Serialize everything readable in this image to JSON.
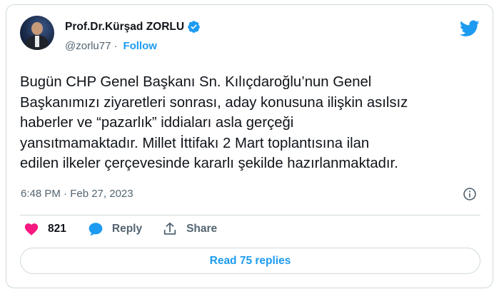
{
  "author": {
    "display_name": "Prof.Dr.Kürşad ZORLU",
    "handle": "@zorlu77",
    "separator": "·",
    "follow_label": "Follow"
  },
  "tweet": {
    "text": "Bugün CHP Genel Başkanı Sn. Kılıçdaroğlu’nun Genel\nBaşkanımızı ziyaretleri sonrası, aday konusuna ilişkin asılsız\nhaberler ve “pazarlık” iddiaları asla gerçeği\nyansıtmamaktadır. Millet İttifakı 2 Mart toplantısına ilan\nedilen ilkeler çerçevesinde kararlı şekilde hazırlanmaktadır.",
    "timestamp": "6:48 PM · Feb 27, 2023"
  },
  "actions": {
    "like_count": "821",
    "reply_label": "Reply",
    "share_label": "Share"
  },
  "read_replies_label": "Read 75 replies",
  "colors": {
    "accent": "#1d9bf0",
    "like": "#f91880",
    "text": "#0f1419",
    "muted": "#536471",
    "border": "#cfd9de"
  },
  "icons": [
    "verified-badge-icon",
    "twitter-bird-icon",
    "info-icon",
    "heart-icon",
    "reply-bubble-icon",
    "share-icon"
  ]
}
